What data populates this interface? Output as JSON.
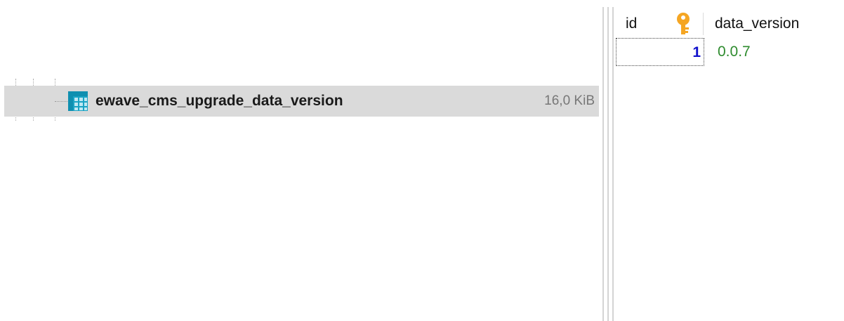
{
  "tree": {
    "selected_item": {
      "name": "ewave_cms_upgrade_data_version",
      "size": "16,0 KiB",
      "icon": "table-icon"
    }
  },
  "grid": {
    "columns": [
      {
        "label": "id",
        "icon": "primary-key-icon"
      },
      {
        "label": "data_version"
      }
    ],
    "rows": [
      {
        "id": "1",
        "data_version": "0.0.7"
      }
    ]
  },
  "colors": {
    "selection_bg": "#dadada",
    "id_value": "#1111cc",
    "string_value": "#2e8b2e",
    "key_icon": "#f5a623",
    "table_icon": "#1aa3c4"
  }
}
